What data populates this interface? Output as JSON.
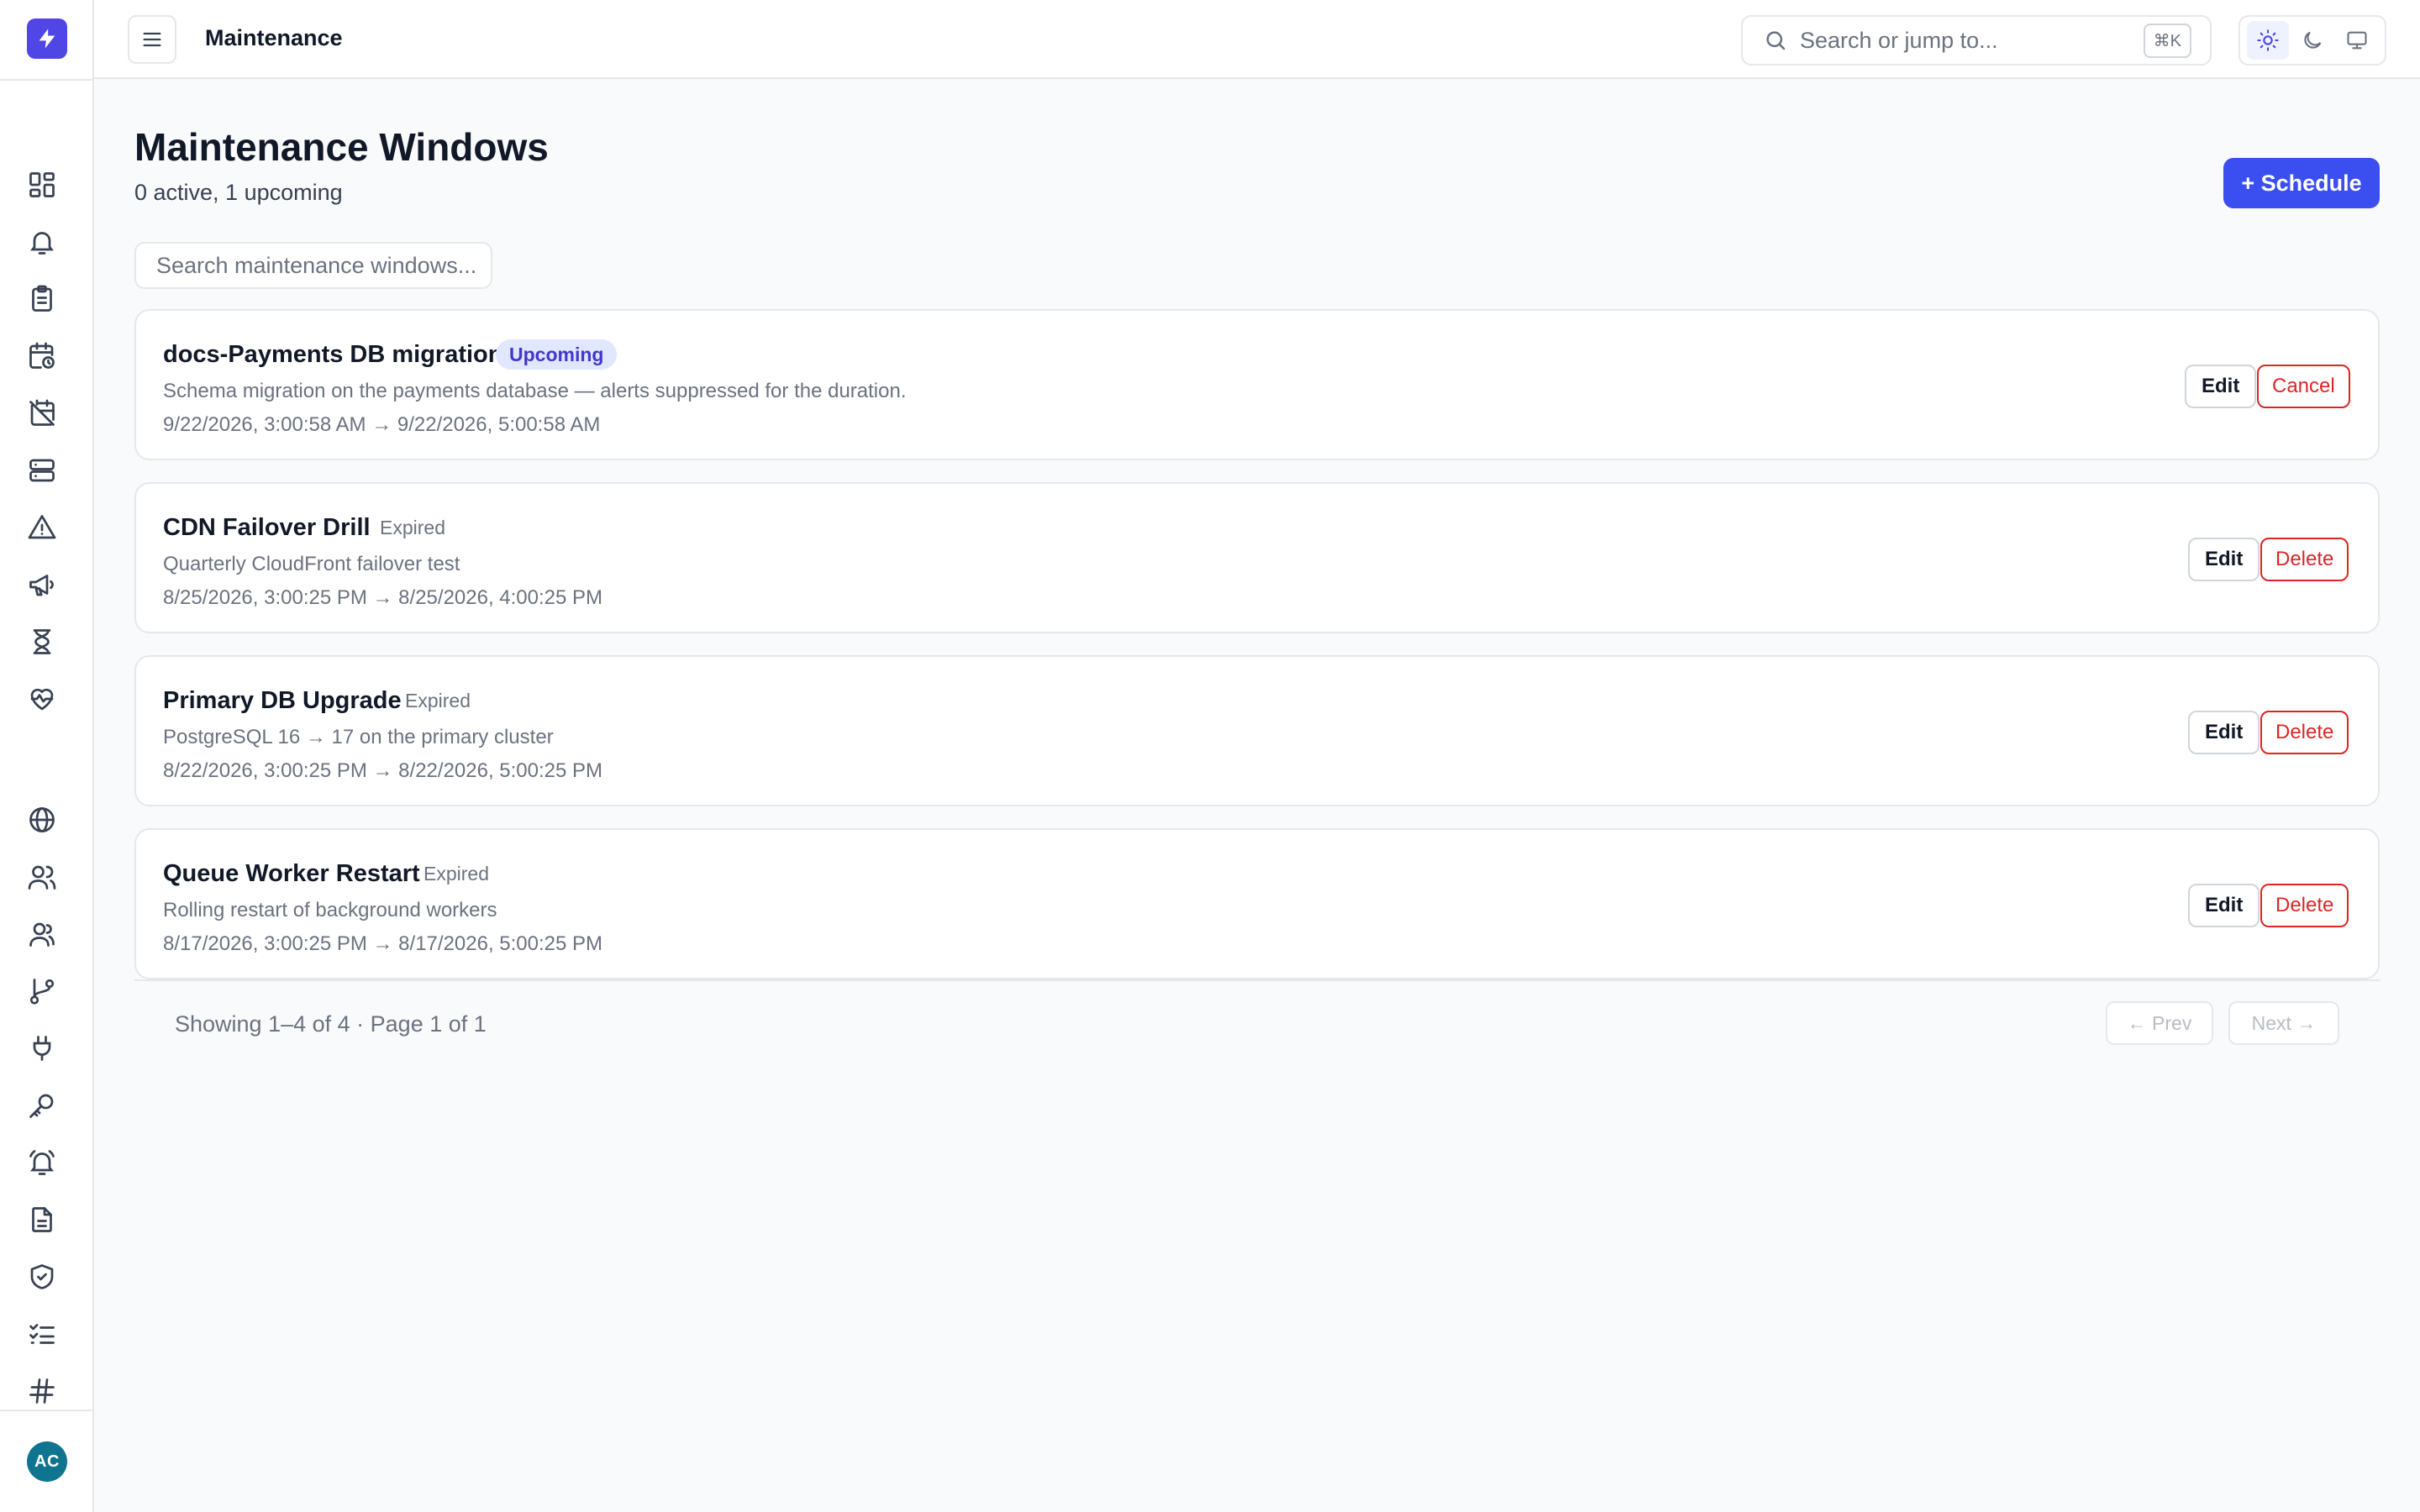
{
  "app": {
    "logo_icon": "lightning-bolt-icon",
    "accent_color": "#4f46e5"
  },
  "sidebar": {
    "items": [
      {
        "icon": "dashboard-icon"
      },
      {
        "icon": "bell-icon"
      },
      {
        "icon": "clipboard-icon"
      },
      {
        "icon": "calendar-clock-icon"
      },
      {
        "icon": "calendar-off-icon"
      },
      {
        "icon": "server-icon"
      },
      {
        "icon": "alert-triangle-icon"
      },
      {
        "icon": "megaphone-icon"
      },
      {
        "icon": "hourglass-icon"
      },
      {
        "icon": "heart-pulse-icon"
      },
      {
        "icon": "globe-icon"
      },
      {
        "icon": "users-icon"
      },
      {
        "icon": "team-icon"
      },
      {
        "icon": "git-branch-icon"
      },
      {
        "icon": "plug-icon"
      },
      {
        "icon": "key-icon"
      },
      {
        "icon": "bell-ring-icon"
      },
      {
        "icon": "document-icon"
      },
      {
        "icon": "shield-check-icon"
      },
      {
        "icon": "checklist-icon"
      },
      {
        "icon": "hash-icon"
      }
    ],
    "avatar_initials": "AC"
  },
  "header": {
    "title": "Maintenance",
    "search_placeholder": "Search or jump to...",
    "search_shortcut": "⌘K",
    "theme_options": [
      "light",
      "dark",
      "system"
    ],
    "theme_selected": "light"
  },
  "main": {
    "title": "Maintenance Windows",
    "subtitle": "0 active, 1 upcoming",
    "schedule_label": "+ Schedule",
    "list_search_placeholder": "Search maintenance windows..."
  },
  "windows": [
    {
      "name": "docs-Payments DB migration",
      "status": "Upcoming",
      "description": "Schema migration on the payments database — alerts suppressed for the duration.",
      "time_range": "9/22/2026, 3:00:58 AM → 9/22/2026, 5:00:58 AM",
      "edit_label": "Edit",
      "action_label": "Cancel"
    },
    {
      "name": "CDN Failover Drill",
      "status": "Expired",
      "description": "Quarterly CloudFront failover test",
      "time_range": "8/25/2026, 3:00:25 PM → 8/25/2026, 4:00:25 PM",
      "edit_label": "Edit",
      "action_label": "Delete"
    },
    {
      "name": "Primary DB Upgrade",
      "status": "Expired",
      "description": "PostgreSQL 16 → 17 on the primary cluster",
      "time_range": "8/22/2026, 3:00:25 PM → 8/22/2026, 5:00:25 PM",
      "edit_label": "Edit",
      "action_label": "Delete"
    },
    {
      "name": "Queue Worker Restart",
      "status": "Expired",
      "description": "Rolling restart of background workers",
      "time_range": "8/17/2026, 3:00:25 PM → 8/17/2026, 5:00:25 PM",
      "edit_label": "Edit",
      "action_label": "Delete"
    }
  ],
  "pagination": {
    "summary": "Showing 1–4 of 4 · Page 1 of 1",
    "prev_label": "← Prev",
    "next_label": "Next →"
  }
}
